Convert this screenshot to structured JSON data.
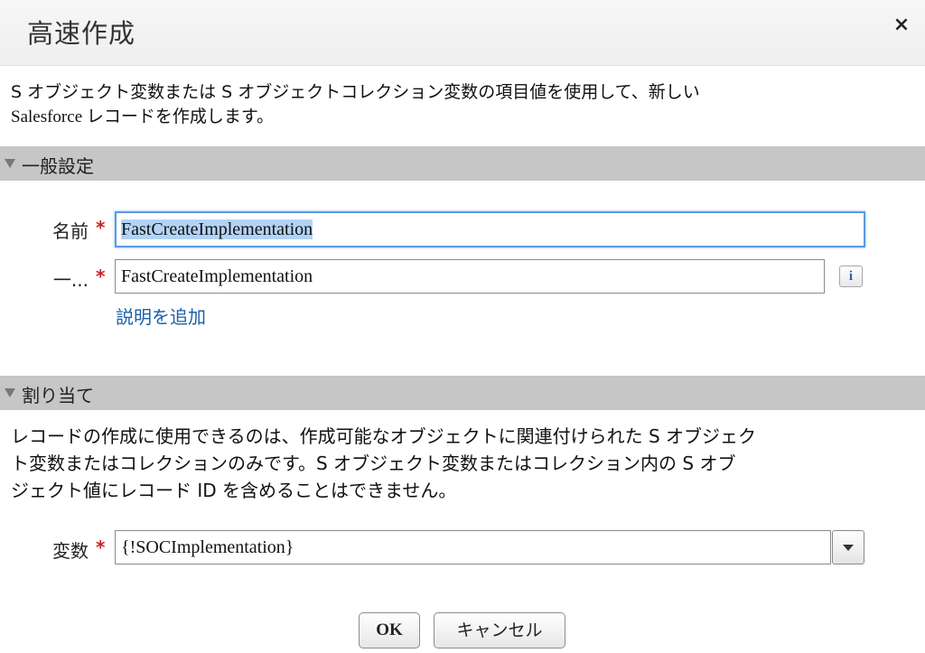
{
  "dialog": {
    "title": "高速作成",
    "close_symbol": "×",
    "description_line1": "S オブジェクト変数または S オブジェクトコレクション変数の項目値を使用して、新しい",
    "description_line2": "Salesforce レコードを作成します。"
  },
  "general_section": {
    "title": "一般設定",
    "name_label": "名前",
    "name_value": "FastCreateImplementation",
    "unique_label": "一...",
    "unique_value": "FastCreateImplementation",
    "info_icon_symbol": "i",
    "add_description_link": "説明を追加"
  },
  "assignment_section": {
    "title": "割り当て",
    "text_line1": "レコードの作成に使用できるのは、作成可能なオブジェクトに関連付けられた S オブジェク",
    "text_line2": "ト変数またはコレクションのみです。S オブジェクト変数またはコレクション内の S オブ",
    "text_line3": "ジェクト値にレコード ID を含めることはできません。",
    "variable_label": "変数",
    "variable_value": "{!SOCImplementation}"
  },
  "required_marker": "*",
  "footer": {
    "ok_label": "OK",
    "cancel_label": "キャンセル"
  },
  "colors": {
    "section_bar": "#c6c6c6",
    "link": "#1a5fa8",
    "required": "#cc2222",
    "focus_border": "#5a9ae0",
    "selection": "#b3d3f5"
  },
  "icons": {
    "close": "close-icon",
    "collapse": "collapse-triangle-icon",
    "info": "info-icon",
    "dropdown": "chevron-down-icon"
  }
}
